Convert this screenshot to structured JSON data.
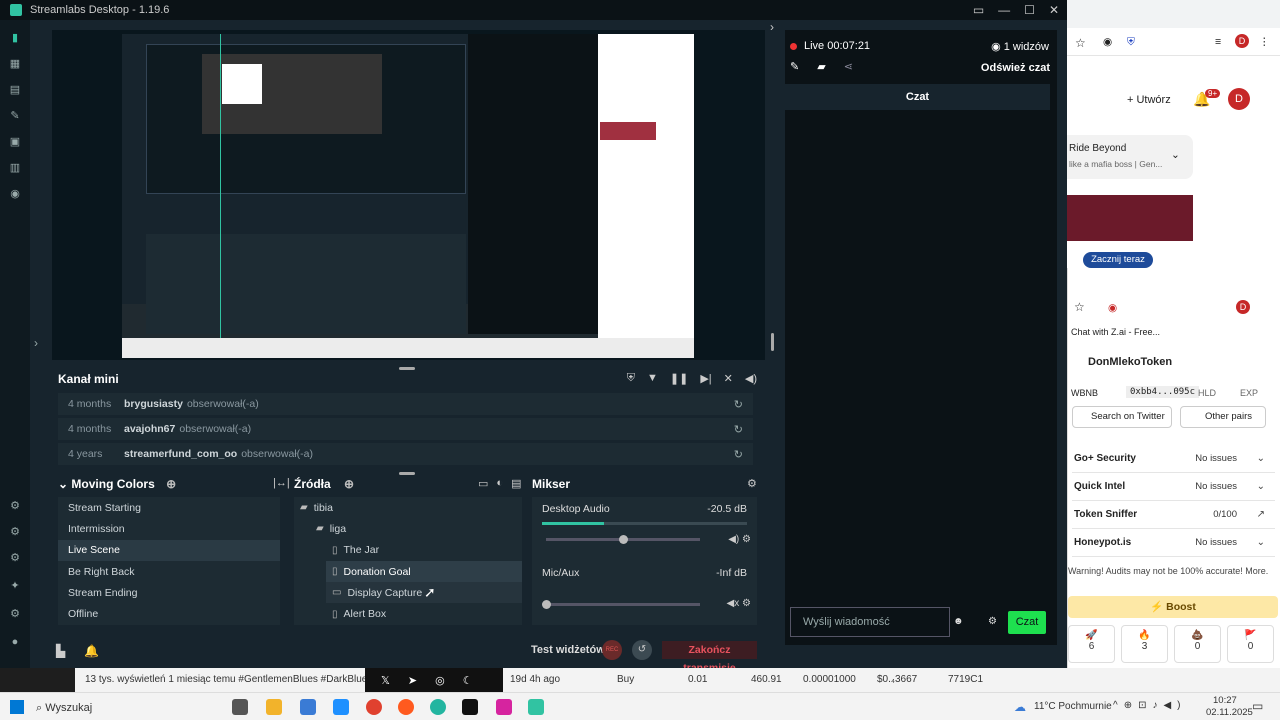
{
  "app": {
    "title": "Streamlabs Desktop - 1.19.6"
  },
  "kanal": {
    "title": "Kanał mini",
    "events": [
      {
        "time": "4 months",
        "name": "brygusiasty",
        "action": "obserwował(-a)"
      },
      {
        "time": "4 months",
        "name": "avajohn67",
        "action": "obserwował(-a)"
      },
      {
        "time": "4 years",
        "name": "streamerfund_com_oo",
        "action": "obserwował(-a)"
      }
    ]
  },
  "scenes": {
    "title": "Moving Colors",
    "items": [
      "Stream Starting",
      "Intermission",
      "Live Scene",
      "Be Right Back",
      "Stream Ending",
      "Offline"
    ],
    "selected": "Live Scene"
  },
  "sources": {
    "title": "Źródła",
    "items": [
      {
        "label": "tibia",
        "indent": 0,
        "icon": "folder"
      },
      {
        "label": "liga",
        "indent": 1,
        "icon": "folder"
      },
      {
        "label": "The Jar",
        "indent": 2,
        "icon": "file"
      },
      {
        "label": "Donation Goal",
        "indent": 2,
        "icon": "file"
      },
      {
        "label": "Display Capture",
        "indent": 2,
        "icon": "monitor"
      },
      {
        "label": "Alert Box",
        "indent": 2,
        "icon": "file"
      }
    ]
  },
  "mixer": {
    "title": "Mikser",
    "channels": [
      {
        "name": "Desktop Audio",
        "value": "-20.5 dB",
        "level": 0.3,
        "volume": 0.5
      },
      {
        "name": "Mic/Aux",
        "value": "-Inf dB",
        "level": 0.0,
        "volume": 0.0
      }
    ]
  },
  "footer": {
    "test_label": "Test widżetów",
    "rec": "REC",
    "end_stream": "Zakończ transmisję"
  },
  "chat": {
    "live": "Live 00:07:21",
    "viewers": "1 widzów",
    "refresh": "Odśwież czat",
    "header": "Czat",
    "placeholder": "Wyślij wiadomość",
    "send": "Czat"
  },
  "chrome_top": {
    "create": "Utwórz",
    "notif": "9+",
    "avatar": "D",
    "card_title": "Ride Beyond",
    "card_sub": "like a mafia boss | Gen...",
    "start_now": "Zacznij teraz"
  },
  "chrome_bottom": {
    "tab": "Chat with Z.ai - Free...",
    "token": "DonMlekoToken",
    "pair": "WBNB",
    "address": "0xbb4...095c",
    "hld": "HLD",
    "exp": "EXP",
    "search_twitter": "Search on Twitter",
    "other_pairs": "Other pairs",
    "checks": [
      {
        "name": "Go+ Security",
        "status": "No issues"
      },
      {
        "name": "Quick Intel",
        "status": "No issues"
      },
      {
        "name": "Token Sniffer",
        "status": "0/100"
      },
      {
        "name": "Honeypot.is",
        "status": "No issues"
      }
    ],
    "warning": "Warning! Audits may not be 100% accurate! More.",
    "boost": "Boost",
    "reactions": [
      {
        "icon": "🚀",
        "count": "6"
      },
      {
        "icon": "🔥",
        "count": "3"
      },
      {
        "icon": "💩",
        "count": "0"
      },
      {
        "icon": "🚩",
        "count": "0"
      }
    ]
  },
  "ticker": {
    "text": "13 tys. wyświetleń  1 miesiąc temu  #GentlemenBlues #DarkBlues -",
    "ago": "19d 4h ago",
    "buy": "Buy",
    "v1": "0.01",
    "v2": "460.91",
    "v3": "0.00001000",
    "v4": "$0.₄3667",
    "v5": "7719C1"
  },
  "taskbar": {
    "search": "Wyszukaj",
    "weather": "11°C Pochmurnie",
    "time": "10:27",
    "date": "02.11.2025"
  }
}
